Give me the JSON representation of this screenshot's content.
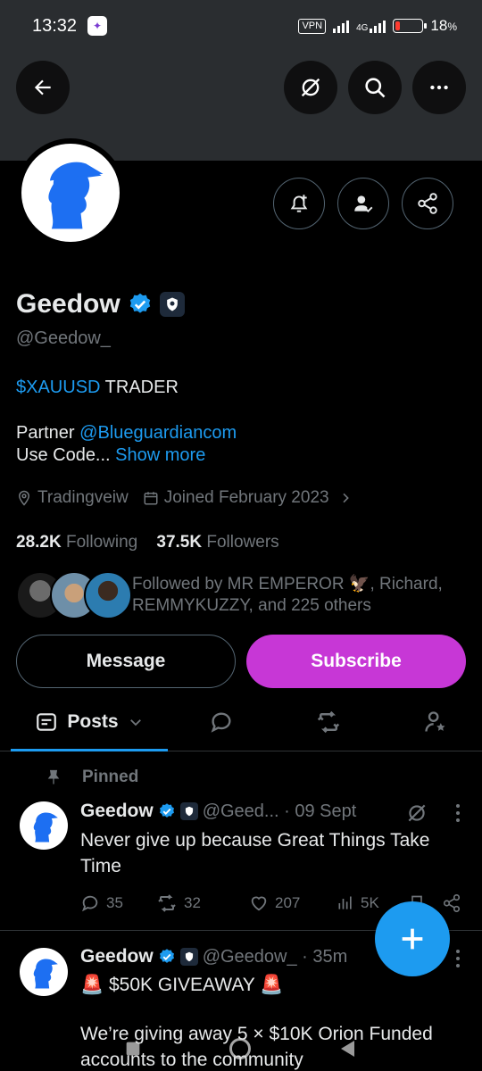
{
  "status": {
    "time": "13:32",
    "vpn": "VPN",
    "network": "4G",
    "battery": "18",
    "battery_level": 0.18,
    "battery_color": "#ff3b30"
  },
  "header": {
    "back_icon": "arrow-left-icon",
    "translate_icon": "grok-icon",
    "search_icon": "search-icon",
    "more_icon": "more-horizontal-icon"
  },
  "profile": {
    "name": "Geedow",
    "handle": "@Geedow_",
    "bio_cashtag": "$XAUUSD",
    "bio_trader": " TRADER",
    "partner_label": "Partner ",
    "partner_link": "@Blueguardiancom",
    "use_code": "Use Code... ",
    "show_more": "Show more",
    "location": "Tradingveiw",
    "joined": "Joined February 2023",
    "following_count": "28.2K",
    "following_label": "Following",
    "followers_count": "37.5K",
    "followers_label": "Followers",
    "followed_by_line1": "Followed by MR EMPEROR 🦅, Richard,",
    "followed_by_line2": "REMMYKUZZY, and 225 others",
    "message_label": "Message",
    "subscribe_label": "Subscribe",
    "accent": "#1d9bf0",
    "subscribe_color": "#c737d6"
  },
  "tabs": {
    "posts_label": "Posts"
  },
  "pinned": {
    "label": "Pinned"
  },
  "posts": [
    {
      "name": "Geedow",
      "handle_time": "@Geed... · 09 Sept",
      "text": "Never give up because Great Things Take Time",
      "replies": "35",
      "reposts": "32",
      "likes": "207",
      "views": "5K"
    },
    {
      "name": "Geedow",
      "handle_time": "@Geedow_ · 35m",
      "line1": "🚨 $50K GIVEAWAY 🚨",
      "line2": "We’re giving away 5 × $10K Orion Funded",
      "line3": "accounts to the community"
    }
  ]
}
